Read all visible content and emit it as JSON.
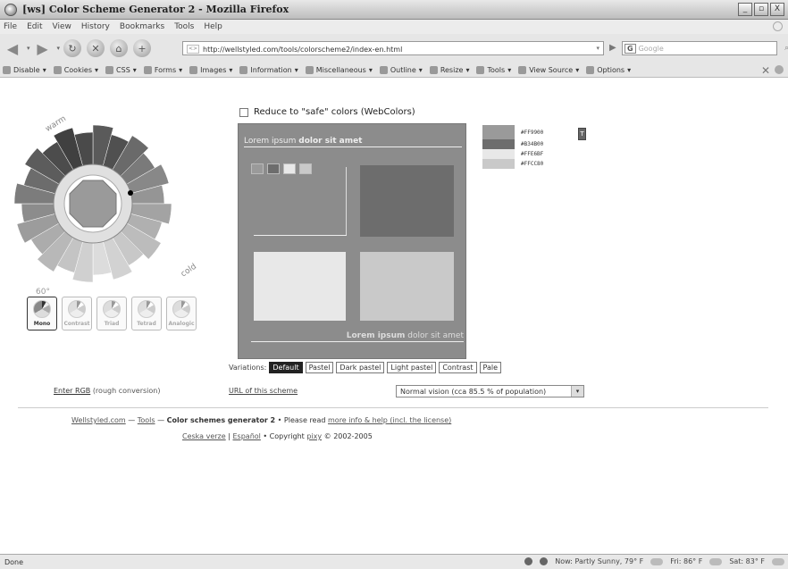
{
  "window": {
    "title": "[ws] Color Scheme Generator 2 - Mozilla Firefox",
    "buttons": [
      "_",
      "▫",
      "X"
    ]
  },
  "menu": [
    "File",
    "Edit",
    "View",
    "History",
    "Bookmarks",
    "Tools",
    "Help"
  ],
  "nav": {
    "url": "http://wellstyled.com/tools/colorscheme2/index-en.html",
    "search_placeholder": "Google"
  },
  "devbar": [
    "Disable",
    "Cookies",
    "CSS",
    "Forms",
    "Images",
    "Information",
    "Miscellaneous",
    "Outline",
    "Resize",
    "Tools",
    "View Source",
    "Options"
  ],
  "wheel": {
    "warm_label": "warm",
    "cold_label": "cold",
    "angle_label": "60°"
  },
  "modes": [
    {
      "label": "Mono",
      "selected": true
    },
    {
      "label": "Contrast",
      "selected": false
    },
    {
      "label": "Triad",
      "selected": false
    },
    {
      "label": "Tetrad",
      "selected": false
    },
    {
      "label": "Analogic",
      "selected": false
    }
  ],
  "enter_rgb": {
    "link": "Enter RGB",
    "note": "(rough conversion)"
  },
  "safe_colors": {
    "label": "Reduce to \"safe\" colors (WebColors)",
    "checked": false
  },
  "preview": {
    "header_plain": "Lorem ipsum",
    "header_bold": "dolor sit amet",
    "footer_bold": "Lorem ipsum",
    "footer_plain": "dolor sit amet"
  },
  "palette": [
    {
      "hex": "#FF9900",
      "color": "#9a9a9a"
    },
    {
      "hex": "#B34B00",
      "color": "#6d6d6d"
    },
    {
      "hex": "#FFE6BF",
      "color": "#e8e8e8"
    },
    {
      "hex": "#FFCC80",
      "color": "#c9c9c9"
    }
  ],
  "palette_button": "T",
  "variations": {
    "label": "Variations:",
    "options": [
      "Default",
      "Pastel",
      "Dark pastel",
      "Light pastel",
      "Contrast",
      "Pale"
    ],
    "active": "Default"
  },
  "url_scheme": "URL of this scheme",
  "vision": {
    "selected": "Normal vision (cca 85.5 % of population)"
  },
  "footer": {
    "line1_site": "Wellstyled.com",
    "line1_sep1": "—",
    "line1_tools": "Tools",
    "line1_sep2": "—",
    "line1_title": "Color schemes generator 2",
    "line1_mid": "• Please read",
    "line1_link": "more info & help (incl. the license)",
    "line2_cz": "Ceska verze",
    "line2_sep": "|",
    "line2_es": "Español",
    "line2_copy": "• Copyright",
    "line2_author": "pixy",
    "line2_years": "© 2002-2005"
  },
  "status": {
    "text": "Done",
    "weather": [
      "Now: Partly Sunny, 79° F",
      "Fri: 86° F",
      "Sat: 83° F"
    ]
  }
}
